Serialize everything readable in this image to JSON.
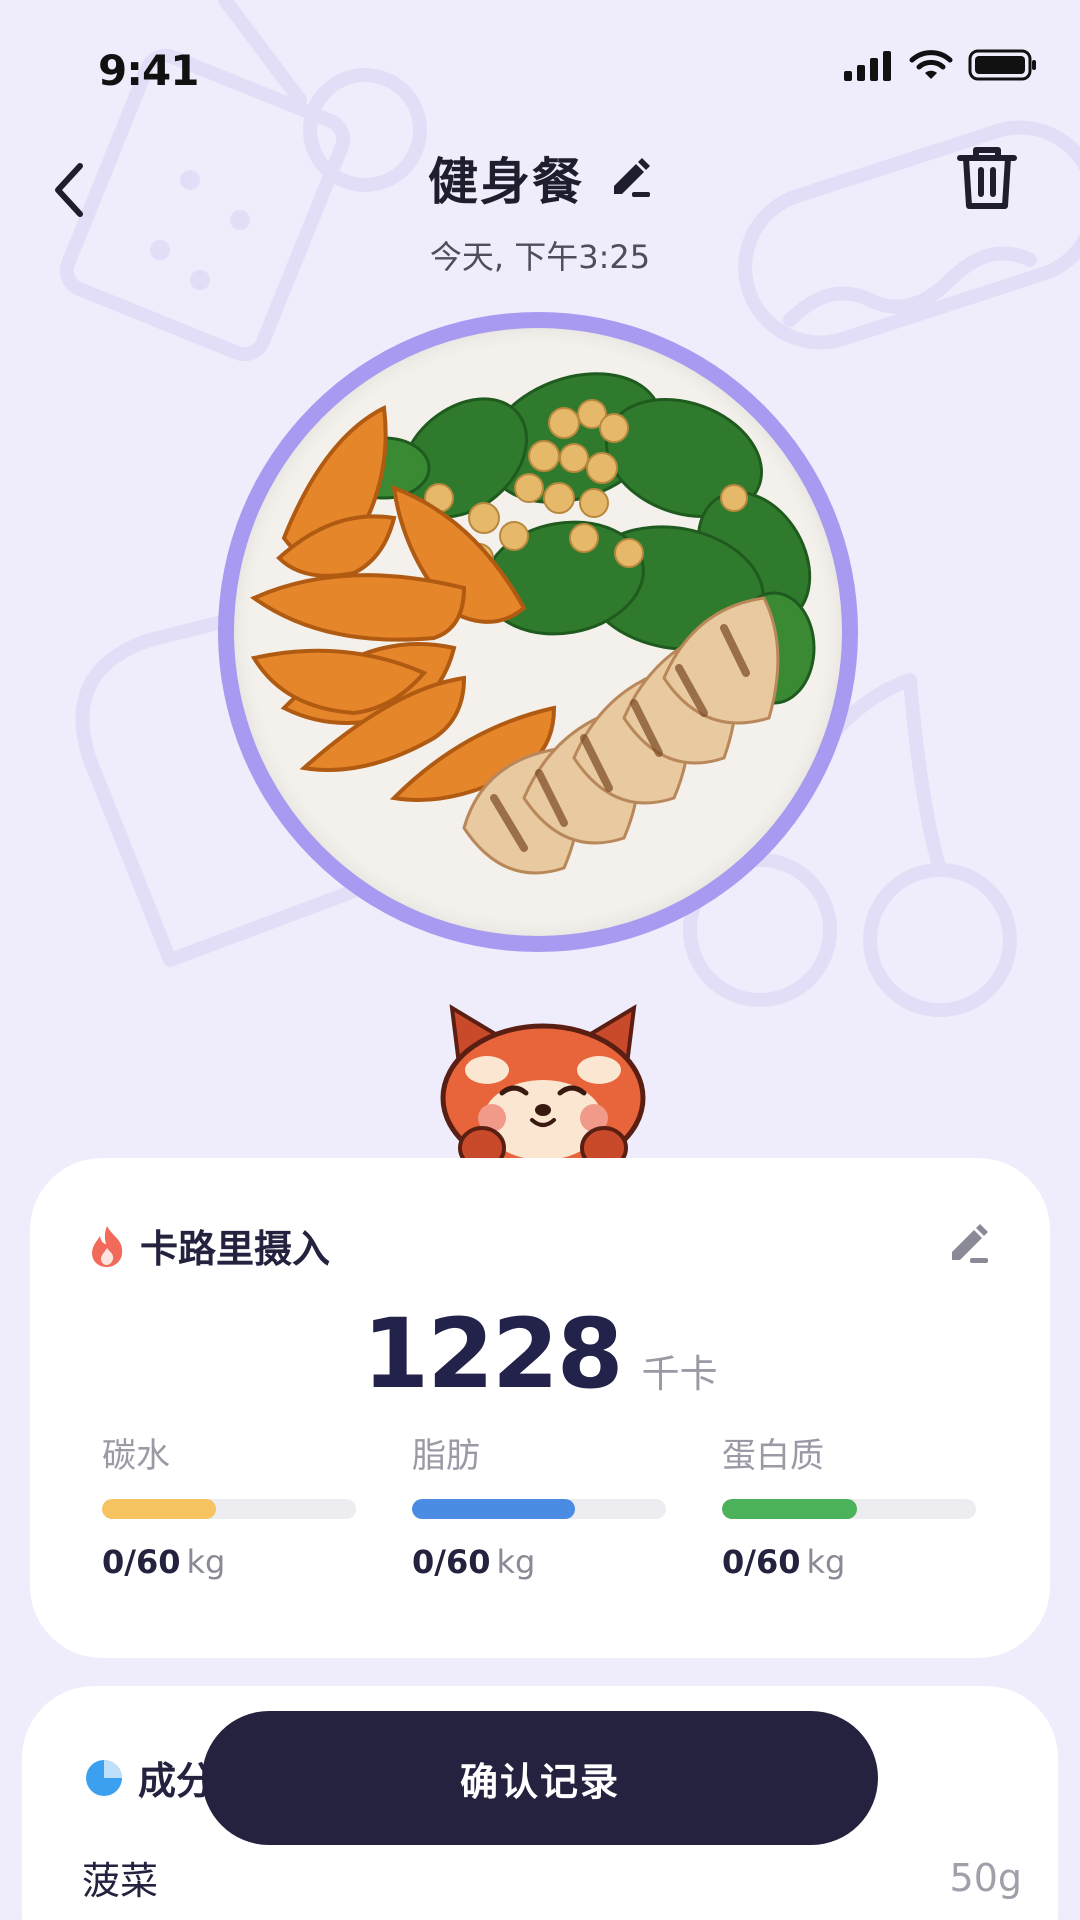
{
  "status_bar": {
    "time": "9:41"
  },
  "header": {
    "title": "健身餐",
    "subtitle": "今天, 下午3:25"
  },
  "calories": {
    "label": "卡路里摄入",
    "value": "1228",
    "unit": "千卡",
    "macros": [
      {
        "label": "碳水",
        "amount": "0/60",
        "unit": "kg",
        "progress": 0.45,
        "color": "#f5c460"
      },
      {
        "label": "脂肪",
        "amount": "0/60",
        "unit": "kg",
        "progress": 0.64,
        "color": "#4a8be4"
      },
      {
        "label": "蛋白质",
        "amount": "0/60",
        "unit": "kg",
        "progress": 0.53,
        "color": "#4cb25a"
      }
    ]
  },
  "ingredients": {
    "label": "成分",
    "items": [
      {
        "name": "菠菜",
        "qty": "50g"
      }
    ]
  },
  "confirm": {
    "label": "确认记录"
  },
  "colors": {
    "background": "#efedfc",
    "plate_ring": "#a79af0",
    "button": "#24223f",
    "flame": "#f26b5a",
    "pie": "#3ba0f0"
  }
}
